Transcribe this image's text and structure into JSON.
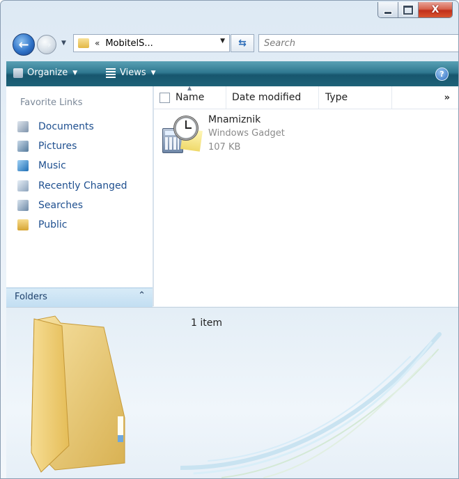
{
  "window": {
    "caption_buttons": {
      "minimize_icon": "minimize-icon",
      "maximize_icon": "maximize-icon",
      "close_icon": "close-icon",
      "close_glyph": "X"
    }
  },
  "navigation": {
    "back_glyph": "←",
    "forward_glyph": "→",
    "address": {
      "prefix": "«",
      "text": "MobitelS..."
    },
    "search": {
      "placeholder": "Search"
    }
  },
  "commandbar": {
    "organize_label": "Organize",
    "views_label": "Views",
    "help_glyph": "?"
  },
  "sidebar": {
    "header": "Favorite Links",
    "items": [
      {
        "label": "Documents",
        "icon": "documents-icon"
      },
      {
        "label": "Pictures",
        "icon": "pictures-icon"
      },
      {
        "label": "Music",
        "icon": "music-icon"
      },
      {
        "label": "Recently Changed",
        "icon": "recently-changed-icon"
      },
      {
        "label": "Searches",
        "icon": "searches-icon"
      },
      {
        "label": "Public",
        "icon": "public-folder-icon"
      }
    ],
    "folders_label": "Folders"
  },
  "filelist": {
    "columns": [
      "Name",
      "Date modified",
      "Type"
    ],
    "more_glyph": "»",
    "files": [
      {
        "name": "Mnamiznik",
        "type": "Windows Gadget",
        "size": "107 KB"
      }
    ]
  },
  "details": {
    "item_count": "1 item"
  },
  "colors": {
    "commandbar": "#1e6278",
    "link_text": "#1e4f8f",
    "folder_yellow": "#f3d37c"
  }
}
